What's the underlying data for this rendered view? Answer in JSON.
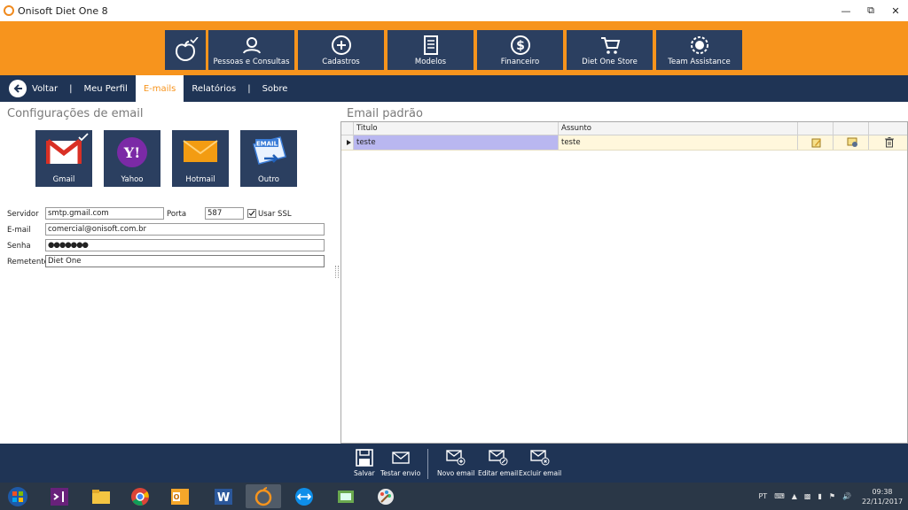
{
  "window": {
    "title": "Onisoft Diet One 8"
  },
  "topmenu": [
    {
      "label": "",
      "icon": "apple-icon"
    },
    {
      "label": "Pessoas e Consultas",
      "icon": "people-search-icon"
    },
    {
      "label": "Cadastros",
      "icon": "plus-circle-icon"
    },
    {
      "label": "Modelos",
      "icon": "document-icon"
    },
    {
      "label": "Financeiro",
      "icon": "dollar-icon"
    },
    {
      "label": "Diet One Store",
      "icon": "cart-icon"
    },
    {
      "label": "Team Assistance",
      "icon": "support-badge-icon"
    }
  ],
  "nav": {
    "back": "Voltar",
    "items": [
      "Meu Perfil",
      "E-mails",
      "Relatórios",
      "Sobre"
    ],
    "active": "E-mails"
  },
  "email_config": {
    "title": "Configurações de email",
    "providers": [
      "Gmail",
      "Yahoo",
      "Hotmail",
      "Outro"
    ],
    "server_label": "Servidor",
    "server_value": "smtp.gmail.com",
    "port_label": "Porta",
    "port_value": "587",
    "ssl_label": "Usar SSL",
    "ssl_checked": true,
    "email_label": "E-mail",
    "email_value": "comercial@onisoft.com.br",
    "password_label": "Senha",
    "password_value": "●●●●●●●",
    "sender_label": "Remetente",
    "sender_value": "Diet One"
  },
  "email_default": {
    "title": "Email padrão",
    "columns": [
      "Titulo",
      "Assunto"
    ],
    "rows": [
      {
        "titulo": "teste",
        "assunto": "teste"
      }
    ]
  },
  "bottom": [
    "Salvar",
    "Testar envio",
    "Novo email",
    "Editar email",
    "Excluir email"
  ],
  "taskbar": {
    "lang": "PT",
    "time": "09:38",
    "date": "22/11/2017"
  },
  "colors": {
    "orange": "#f7941d",
    "navy": "#1f3455",
    "tile": "#2b3f60",
    "row": "#fff7dc",
    "selected": "#b9b7f0"
  }
}
